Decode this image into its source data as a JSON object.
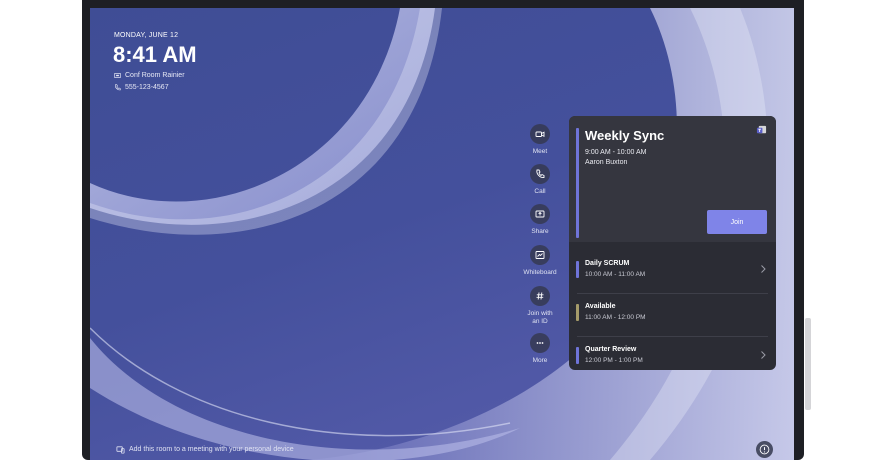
{
  "status": {
    "date": "MONDAY, JUNE 12",
    "time": "8:41 AM",
    "room_name": "Conf Room Rainier",
    "phone": "555-123-4567",
    "room_icon": "room-icon",
    "phone_icon": "phone-icon"
  },
  "rail": {
    "items": [
      {
        "label": "Meet",
        "icon": "video-icon"
      },
      {
        "label": "Call",
        "icon": "phone-icon"
      },
      {
        "label": "Share",
        "icon": "share-screen-icon"
      },
      {
        "label": "Whiteboard",
        "icon": "whiteboard-icon"
      },
      {
        "label": "Join with",
        "label2": "an ID",
        "icon": "hashtag-icon"
      },
      {
        "label": "More",
        "icon": "more-icon"
      }
    ]
  },
  "meeting": {
    "title": "Weekly Sync",
    "time_range": "9:00 AM - 10:00 AM",
    "organizer": "Aaron Buxton",
    "join_label": "Join",
    "accent": "#6f74d9",
    "join_color": "#7f84e8"
  },
  "agenda": [
    {
      "title": "Daily SCRUM",
      "time": "10:00 AM - 11:00 AM",
      "color": "#6f74d9"
    },
    {
      "title": "Available",
      "time": "11:00 AM - 12:00 PM",
      "color": "#a59b6a"
    },
    {
      "title": "Quarter Review",
      "time": "12:00 PM - 1:00 PM",
      "color": "#6f74d9"
    }
  ],
  "footer": {
    "text": "Add this room to a meeting with your personal device",
    "icon": "cast-device-icon"
  },
  "help_icon": "help-icon"
}
